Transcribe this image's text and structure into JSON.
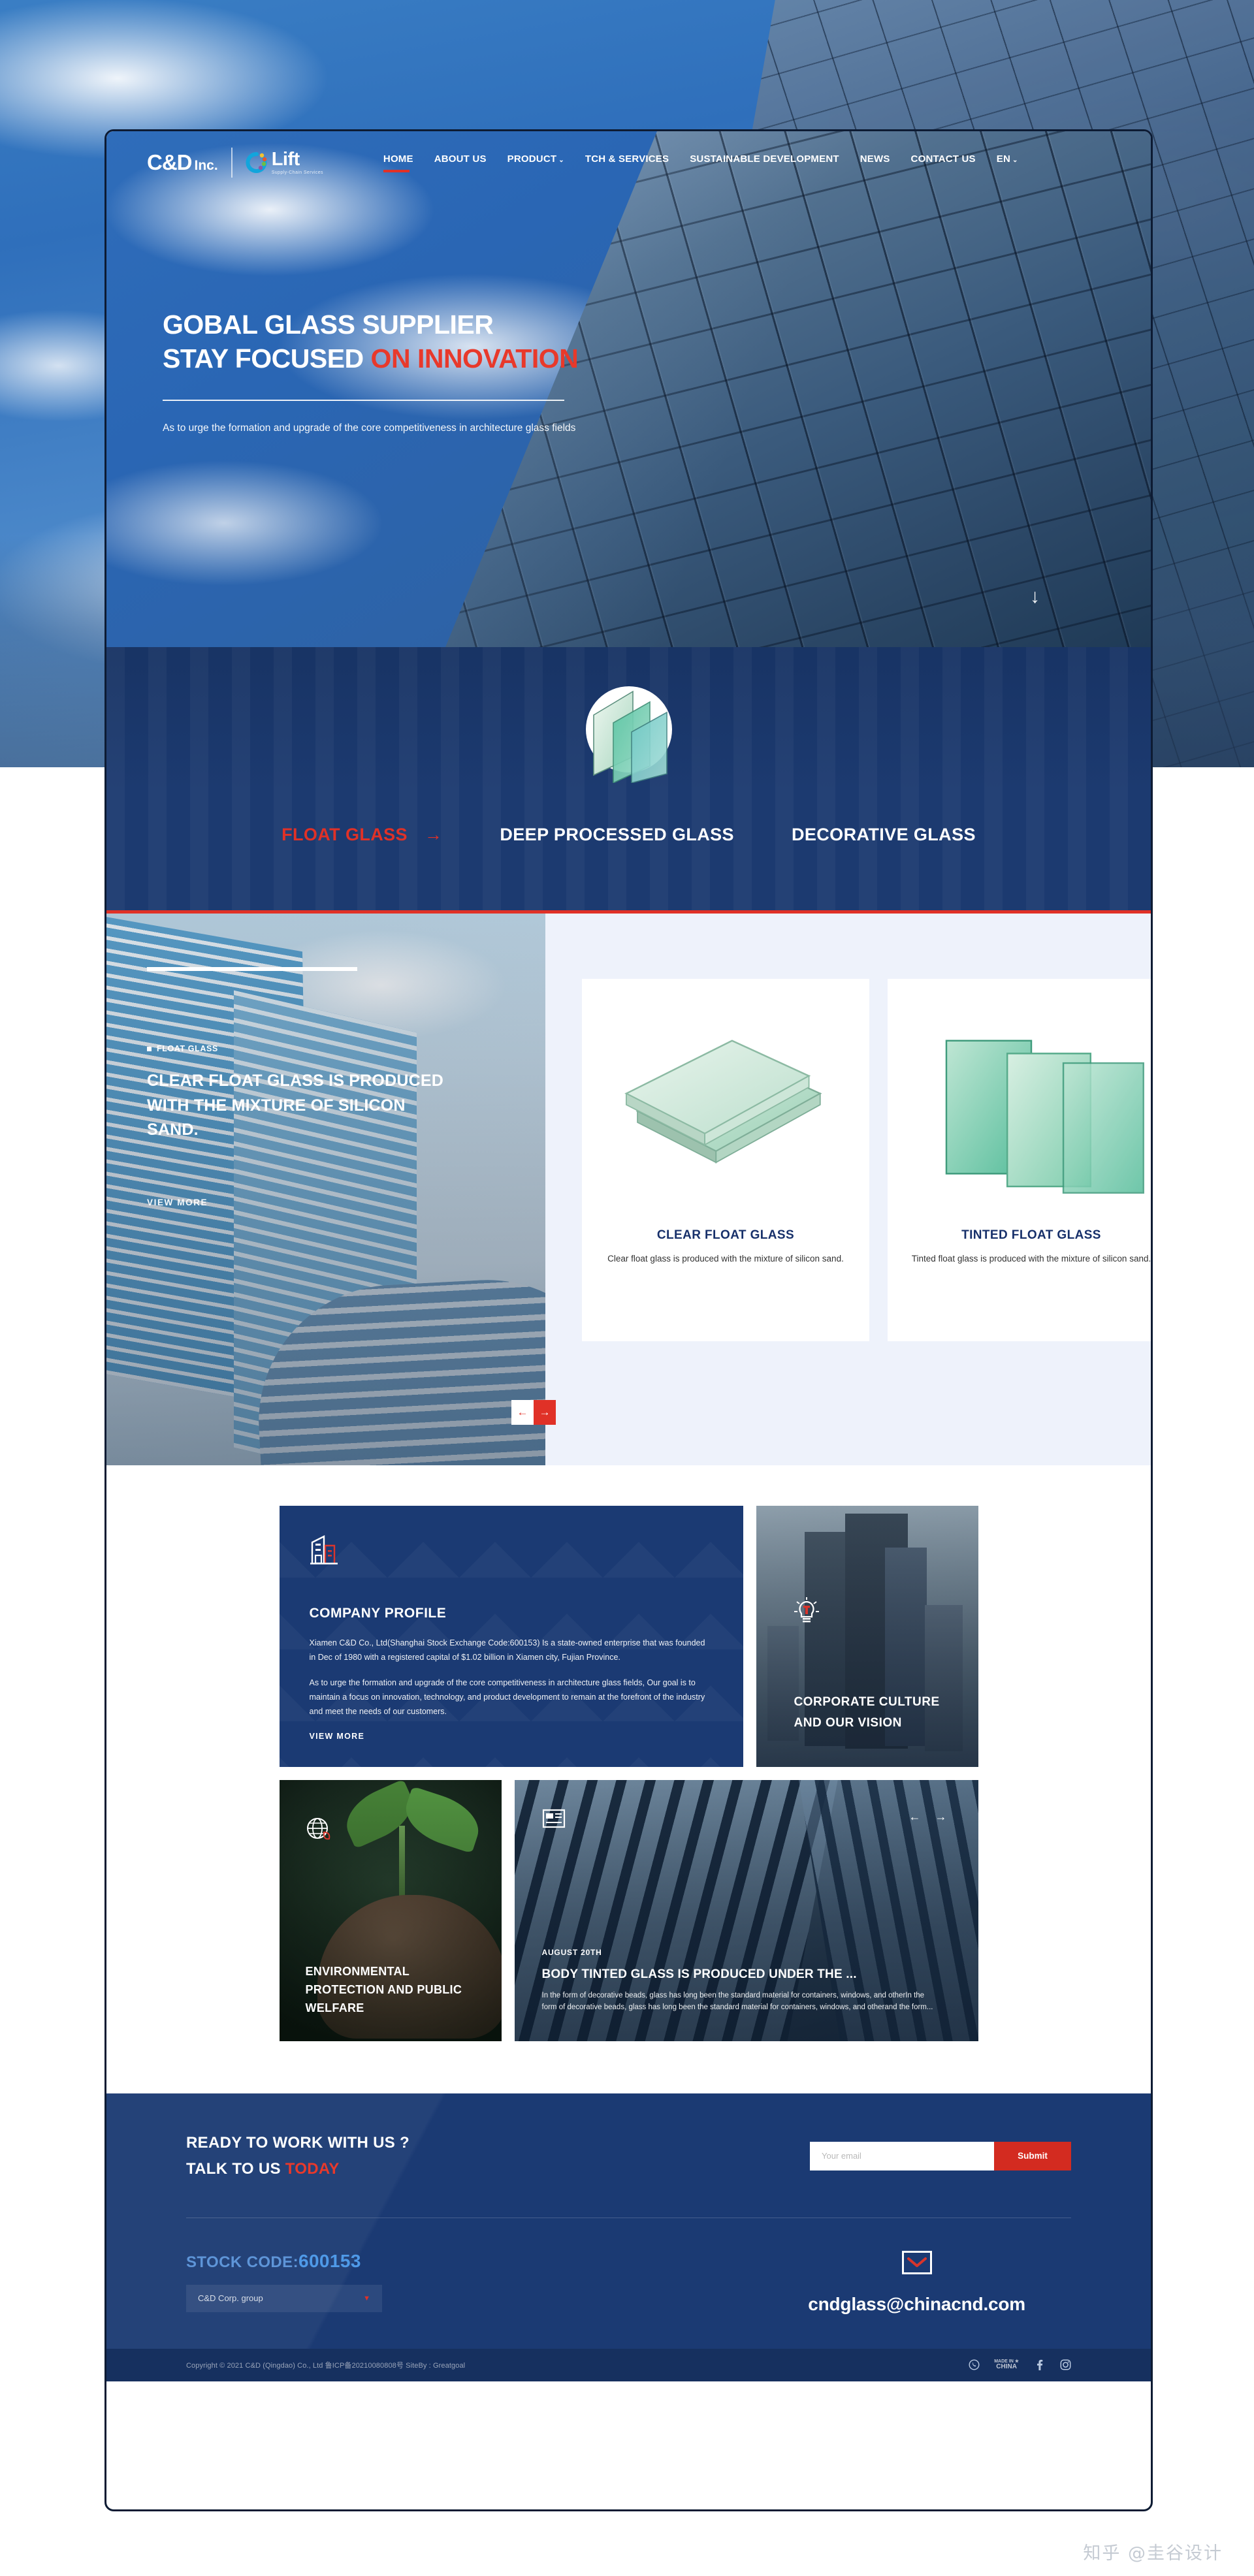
{
  "brand": {
    "cd": "C&D",
    "inc": "Inc.",
    "lift": "Lift",
    "lift_sub": "Supply-Chain Services"
  },
  "nav": {
    "items": [
      {
        "label": "HOME",
        "active": true,
        "caret": ""
      },
      {
        "label": "ABOUT US",
        "active": false,
        "caret": ""
      },
      {
        "label": "PRODUCT",
        "active": false,
        "caret": "⌄"
      },
      {
        "label": "TCH & SERVICES",
        "active": false,
        "caret": ""
      },
      {
        "label": "SUSTAINABLE DEVELOPMENT",
        "active": false,
        "caret": ""
      },
      {
        "label": "NEWS",
        "active": false,
        "caret": ""
      },
      {
        "label": "CONTACT US",
        "active": false,
        "caret": ""
      },
      {
        "label": "EN",
        "active": false,
        "caret": "⌄"
      }
    ]
  },
  "hero": {
    "line1": "GOBAL GLASS SUPPLIER",
    "line2_white": "STAY FOCUSED ",
    "line2_red": "ON INNOVATION",
    "paragraph": "As to urge the formation and upgrade of the core competitiveness in architecture glass fields",
    "scroll_icon": "↓"
  },
  "categories": {
    "emblem_name": "glass-panes-emblem",
    "tabs": [
      {
        "label": "FLOAT GLASS",
        "active": true,
        "arrow": "→"
      },
      {
        "label": "DEEP PROCESSED GLASS",
        "active": false,
        "arrow": ""
      },
      {
        "label": "DECORATIVE GLASS",
        "active": false,
        "arrow": ""
      }
    ]
  },
  "products": {
    "eyebrow": "FLOAT GLASS",
    "headline": "CLEAR FLOAT GLASS IS PRODUCED WITH THE MIXTURE OF SILICON SAND.",
    "view_more": "VIEW MORE",
    "prev_icon": "←",
    "next_icon": "→",
    "cards": [
      {
        "name": "CLEAR FLOAT GLASS",
        "desc": "Clear float glass is produced with the mixture of silicon sand."
      },
      {
        "name": "TINTED FLOAT GLASS",
        "desc": "Tinted float glass is produced with the mixture of silicon sand."
      }
    ]
  },
  "about": {
    "profile": {
      "icon_name": "building-icon",
      "title": "COMPANY PROFILE",
      "para1": "Xiamen C&D Co., Ltd(Shanghai Stock Exchange Code:600153) Is a state-owned enterprise that was founded in Dec of 1980 with a registered capital of $1.02 billion in Xiamen city, Fujian Province.",
      "para2": "As to urge the formation and upgrade of the core competitiveness in architecture glass fields, Our goal is to maintain a focus on innovation, technology, and product development to remain at the forefront of the industry and meet the needs of our customers.",
      "view_more": "VIEW MORE"
    },
    "culture": {
      "icon_name": "lightbulb-icon",
      "title_line1": "CORPORATE CULTURE",
      "title_line2": "AND  OUR VISION"
    },
    "environment": {
      "icon_name": "globe-leaf-icon",
      "title": "ENVIRONMENTAL PROTECTION AND PUBLIC WELFARE"
    },
    "news": {
      "icon_name": "news-article-icon",
      "date": "AUGUST 20TH",
      "headline": "BODY TINTED GLASS IS PRODUCED UNDER THE ...",
      "excerpt": "In the form of decorative beads, glass has long been the standard material for containers, windows, and otherIn the form of decorative beads, glass has long been the standard material for containers, windows, and otherand  the form...",
      "prev_icon": "←",
      "next_icon": "→"
    }
  },
  "footer": {
    "cta_line1": "READY TO WORK WITH US ?",
    "cta_line2_white": "TALK TO US ",
    "cta_line2_red": "TODAY",
    "email_placeholder": "Your email",
    "email_value": "",
    "submit_label": "Submit",
    "stock_label": "STOCK CODE:",
    "stock_number": "600153",
    "stock_select_value": "C&D Corp. group",
    "stock_select_caret": "▼",
    "contact_email": "cndglass@chinacnd.com",
    "copyright": "Copyright © 2021 C&D (Qingdao) Co., Ltd  鲁ICP备20210080808号  SiteBy : Greatgoal",
    "social": [
      {
        "name": "whatsapp-icon",
        "glyph": "✆"
      },
      {
        "name": "made-in-china-icon",
        "top": "MADE IN ★",
        "bottom": "CHINA"
      },
      {
        "name": "facebook-icon",
        "glyph": "f"
      },
      {
        "name": "instagram-icon",
        "glyph": "□"
      }
    ]
  },
  "watermark": "知乎 @圭谷设计",
  "colors": {
    "brand_blue": "#1b3a73",
    "accent_red": "#e03127",
    "hero_blue": "#2f6dba"
  }
}
